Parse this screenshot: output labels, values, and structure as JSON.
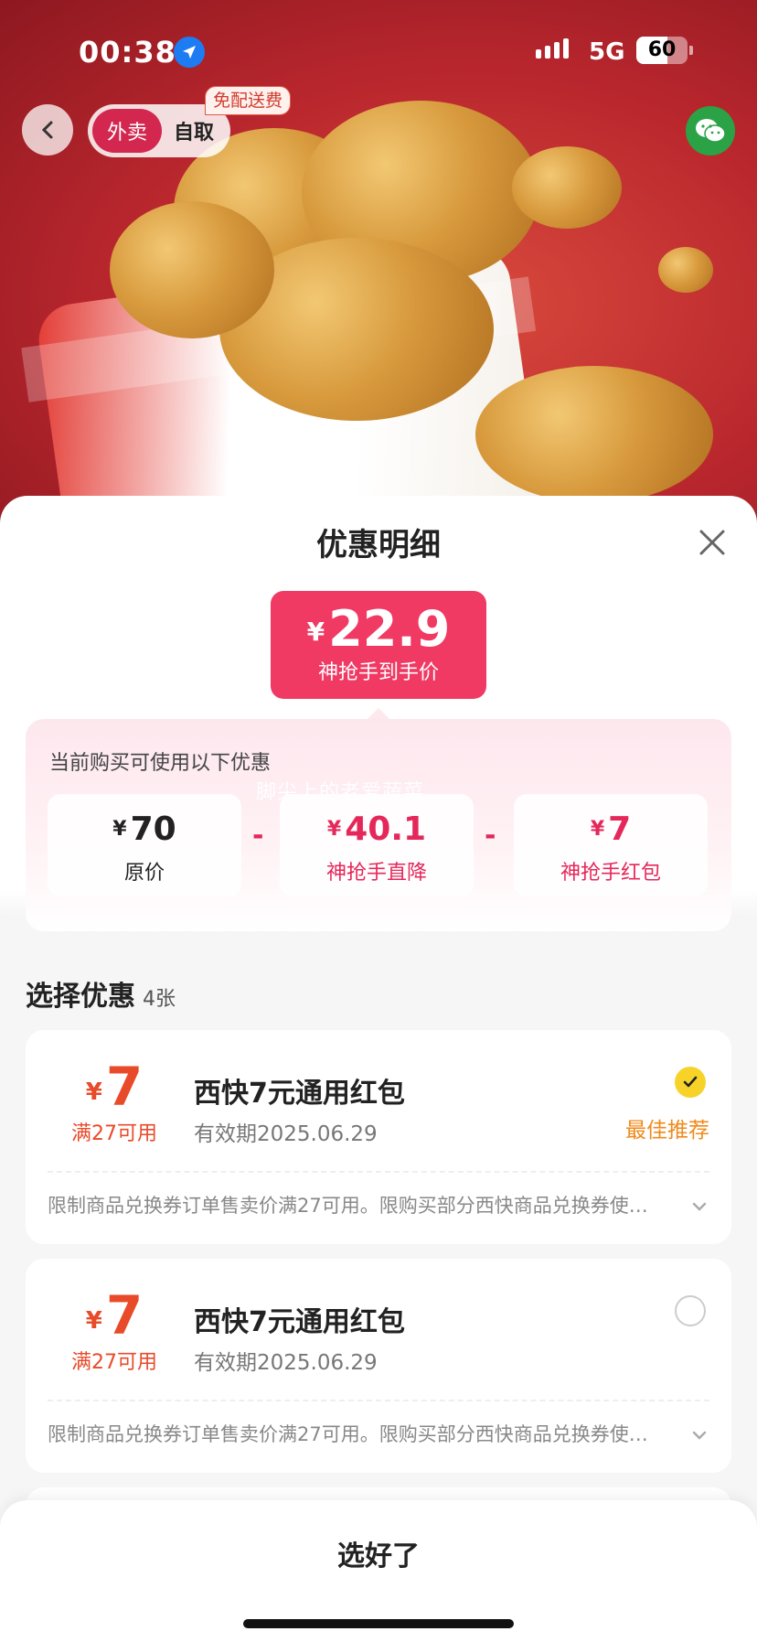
{
  "status_bar": {
    "time": "00:38",
    "network": "5G",
    "battery": "60",
    "battery_level": 0.6
  },
  "header": {
    "mode_delivery": "外卖",
    "mode_pickup": "自取",
    "free_delivery_badge": "免配送费",
    "icons": {
      "back": "back-arrow-icon",
      "share": "wechat-icon",
      "location": "location-arrow-icon"
    }
  },
  "sheet": {
    "title": "优惠明细",
    "final_price": {
      "currency": "¥",
      "amount": "22.9",
      "label": "神抢手到手价"
    },
    "breakdown": {
      "hint": "当前购买可使用以下优惠",
      "watermark": "脚尖上的老爱蔬菜",
      "items": [
        {
          "currency": "¥",
          "amount": "70",
          "label": "原价"
        },
        {
          "currency": "¥",
          "amount": "40.1",
          "label": "神抢手直降"
        },
        {
          "currency": "¥",
          "amount": "7",
          "label": "神抢手红包"
        }
      ],
      "operator": "-"
    },
    "select": {
      "title": "选择优惠",
      "count": "4张"
    },
    "coupons": [
      {
        "currency": "¥",
        "value": "7",
        "condition": "满27可用",
        "name": "西快7元通用红包",
        "validity": "有效期2025.06.29",
        "selected": true,
        "tag": "最佳推荐",
        "description": "限制商品兑换券订单售卖价满27可用。限购买部分西快商品兑换券使…"
      },
      {
        "currency": "¥",
        "value": "7",
        "condition": "满27可用",
        "name": "西快7元通用红包",
        "validity": "有效期2025.06.29",
        "selected": false,
        "tag": "",
        "description": "限制商品兑换券订单售卖价满27可用。限购买部分西快商品兑换券使…"
      }
    ],
    "confirm_button": "选好了"
  },
  "colors": {
    "accent": "#f03a64",
    "coupon_red": "#e84b2a",
    "best_orange": "#f08a1b",
    "check_yellow": "#f7d32a"
  }
}
